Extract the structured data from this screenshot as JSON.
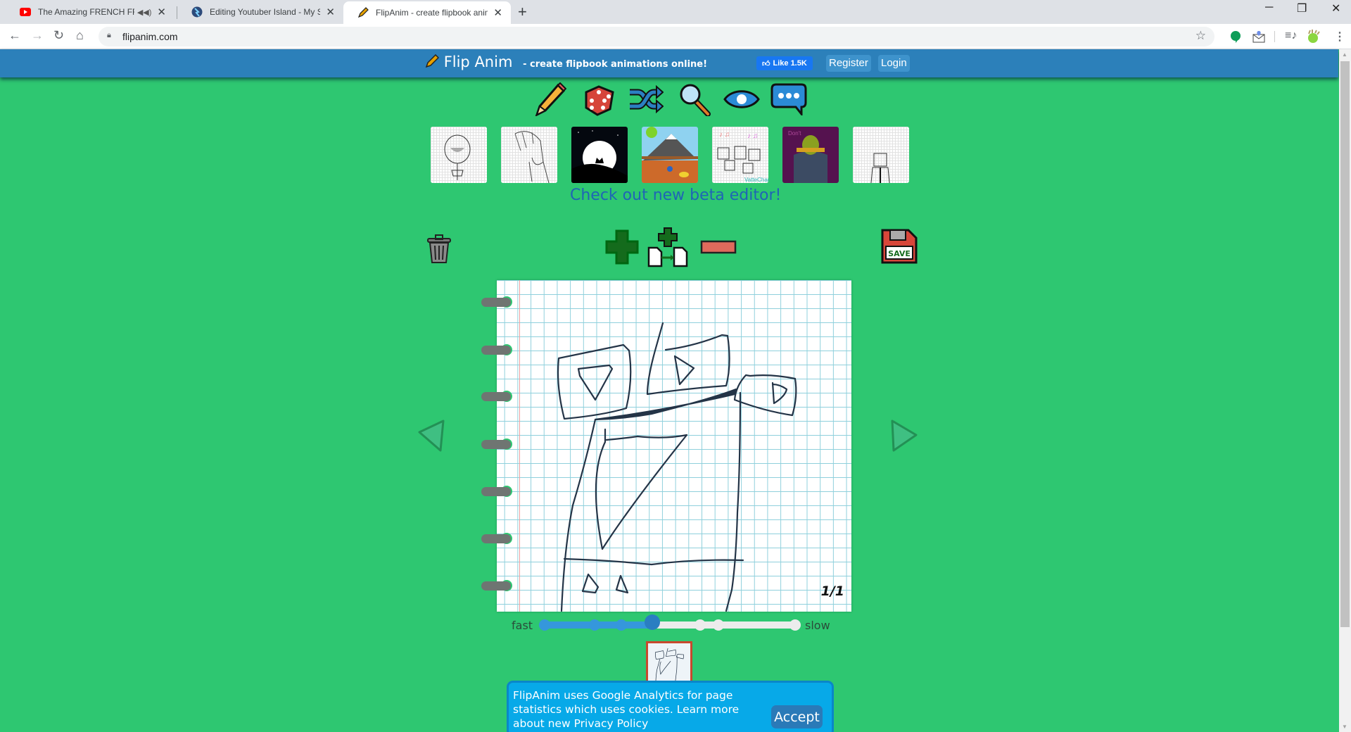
{
  "browser": {
    "tabs": [
      {
        "title": "The Amazing FRENCH FRY Ra",
        "favicon": "youtube-icon",
        "audio": true,
        "active": false
      },
      {
        "title": "Editing Youtuber Island - My Sing",
        "favicon": "world-icon",
        "audio": false,
        "active": false
      },
      {
        "title": "FlipAnim - create flipbook animat",
        "favicon": "pencil-icon",
        "audio": false,
        "active": true
      }
    ],
    "new_tab_label": "+",
    "url": "flipanim.com",
    "window_controls": {
      "minimize": "─",
      "restore": "❐",
      "close": "✕"
    }
  },
  "site": {
    "logo_text": "Flip Anim",
    "tagline": "- create flipbook animations online!",
    "fb_like": "Like 1.5K",
    "register": "Register",
    "login": "Login"
  },
  "tools": [
    {
      "name": "pencil-tool",
      "icon": "pencil-icon"
    },
    {
      "name": "random-tool",
      "icon": "dice-icon"
    },
    {
      "name": "shuffle-tool",
      "icon": "shuffle-icon"
    },
    {
      "name": "search-tool",
      "icon": "magnifier-icon"
    },
    {
      "name": "view-tool",
      "icon": "eye-icon"
    },
    {
      "name": "chat-tool",
      "icon": "chat-icon"
    }
  ],
  "featured_thumbnails": [
    {
      "subject": "sketch girl"
    },
    {
      "subject": "sketch boy profile"
    },
    {
      "subject": "moon night silhouette"
    },
    {
      "subject": "mountain runner"
    },
    {
      "subject": "singing cats"
    },
    {
      "subject": "don't wonder"
    },
    {
      "subject": "sketch man tie"
    }
  ],
  "beta_link": "Check out new beta editor!",
  "actions": {
    "delete": "trash-icon",
    "add_frame": "plus-icon",
    "duplicate_frame": "copy-frame-icon",
    "remove_frame": "minus-icon",
    "save": "SAVE"
  },
  "canvas": {
    "frame_counter": "1/1",
    "current_frame": 1,
    "total_frames": 1
  },
  "speed": {
    "fast_label": "fast",
    "slow_label": "slow",
    "steps": 7,
    "selected_step": 4,
    "selected_fraction": 0.43
  },
  "cookie_banner": {
    "message": "FlipAnim uses Google Analytics for page statistics which uses cookies. Learn more about new Privacy Policy",
    "accept": "Accept"
  },
  "colors": {
    "page_bg": "#2ec771",
    "header_bg": "#2c80ba",
    "beta_link": "#1f65b5",
    "slider_active": "#3597dc",
    "cookie_bg": "#07a9e8"
  }
}
